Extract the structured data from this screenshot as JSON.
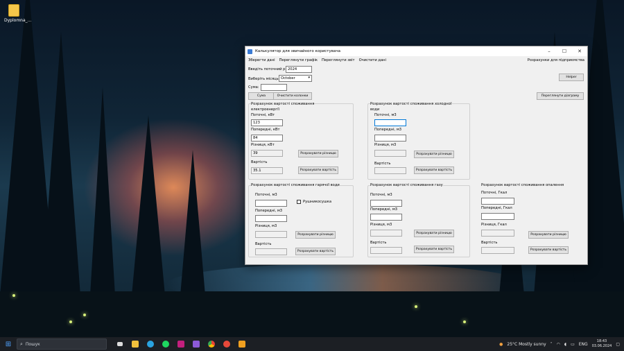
{
  "desktop": {
    "icon_label": "Dyplomna_...",
    "icon_name": "folder-icon"
  },
  "window": {
    "title": "Калькулятор для звичайного користувача",
    "controls": {
      "minimize": "–",
      "maximize": "☐",
      "close": "✕"
    }
  },
  "menu": {
    "items": [
      "Зберегти дані",
      "Переглянути графік",
      "Переглянути звіт",
      "Очистити дані"
    ],
    "right": "Розрахунки для підприємства"
  },
  "top": {
    "year_label": "Введіть поточний рік:",
    "year_value": "2024",
    "month_label": "Виберіть місяць:",
    "month_value": "October",
    "sum_label": "Сума:",
    "sum_value": "",
    "sum_button": "Сума",
    "clear_button": "Очистити колонки",
    "helper_button": "Helper",
    "diagram_button": "Переглянути діаграму"
  },
  "electricity": {
    "title_line1": "Розрахунок вартості споживання",
    "title_line2": "електроенергії",
    "current_label": "Поточні, кВт",
    "current_value": "123",
    "previous_label": "Попередні, кВт",
    "previous_value": "84",
    "diff_label": "Різниця, кВт",
    "diff_value": "39",
    "diff_button": "Розрахувати різницю",
    "cost_label": "Вартість",
    "cost_value": "35.1",
    "cost_button": "Розрахувати вартість"
  },
  "cold_water": {
    "title_line1": "Розрахунок вартості споживання холодної",
    "title_line2": "води",
    "current_label": "Поточні, м3",
    "current_value": "",
    "previous_label": "Попередні, м3",
    "previous_value": "",
    "diff_label": "Різниця, м3",
    "diff_value": "",
    "diff_button": "Розрахувати різницю",
    "cost_label": "Вартість",
    "cost_value": "",
    "cost_button": "Розрахувати вартість"
  },
  "hot_water": {
    "title": "Розрахунок вартості споживання гарячої води",
    "current_label": "Поточні, м3",
    "previous_label": "Попередні, м3",
    "diff_label": "Різниця, м3",
    "diff_button": "Розрахувати різницю",
    "cost_label": "Вартість",
    "cost_button": "Розрахувати вартість",
    "towel_label": "Рушникосушка"
  },
  "gas": {
    "title": "Розрахунок вартості споживання газу",
    "current_label": "Поточні, м3",
    "previous_label": "Попередні, м3",
    "diff_label": "Різниця, м3",
    "diff_button": "Розрахувати різницю",
    "cost_label": "Вартість",
    "cost_button": "Розрахувати вартість"
  },
  "heating": {
    "title": "Розрахунок вартості споживання опалення",
    "current_label": "Поточні, Гкал",
    "previous_label": "Попередні, Гкал",
    "diff_label": "Різниця, Гкал",
    "diff_button": "Розрахувати різницю",
    "cost_label": "Вартість",
    "cost_button": "Розрахувати вартість"
  },
  "taskbar": {
    "search_text": "Пошук",
    "weather": "25°C  Mostly sunny",
    "lang": "ENG",
    "time": "18:43",
    "date": "03.06.2024",
    "apps": [
      "task-view-icon",
      "file-explorer-icon",
      "telegram-icon",
      "spotify-icon",
      "rider-icon",
      "visual-studio-icon",
      "chrome-icon",
      "chrome-canary-icon",
      "app-icon"
    ]
  }
}
